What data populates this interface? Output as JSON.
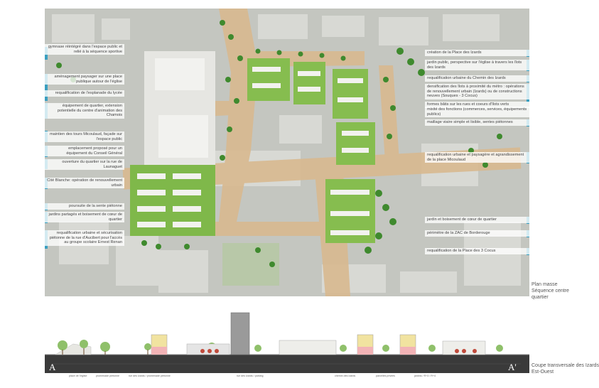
{
  "caption_plan": [
    "Plan masse",
    "Séquence centre",
    "quartier"
  ],
  "caption_section": [
    "Coupe transversale des Izards",
    "Est-Ouest"
  ],
  "section_letters": {
    "left": "A",
    "right": "A'"
  },
  "section_small_labels": [
    "place de l'église",
    "promenade piétonne",
    "rue des Izards / promenade piétonne",
    "rue des Izards / parking",
    "chemin des Izards",
    "parcelles privées",
    "jardins / R+3 / R+4"
  ],
  "left_annotations": [
    "gymnase réintégré dans l'espace public et relié à la séquence sportive",
    "aménagement paysager sur une place publique autour de l'église",
    "requalification de l'esplanade du lycée",
    "équipement de quartier, extension potentielle du centre d'animation des Chamois",
    "maintien des tours Micoulaud, façade sur l'espace public",
    "emplacement proposé pour un équipement du Conseil Général",
    "ouverture du quartier sur la rue de Launaguet",
    "Cité Blanche: opération de renouvellement urbain",
    "poursuite de la sente piétonne",
    "jardins partagés et boisement de cœur de quartier",
    "requalification urbaine et sécurisation piétonne de la rue d'Aucibert pour l'accès au groupe scolaire Ernest Renan"
  ],
  "right_annotations": [
    "création de la Place des Izards",
    "jardin public, perspective sur l'église à travers les îlots des Izards",
    "requalification urbaine du Chemin des Izards",
    "densification des îlots à proximité du métro : opérations de renouvellement urbain (Izards) ou de constructions neuves (Souques - 3 Cocus)",
    "formes bâtis sur les rues et coeurs d'îlots verts",
    "mixité des fonctions (commerces, services, équipements publics)",
    "maillage viaire simple et lisible, sentes piétonnes",
    "requalification urbaine et paysagère et agrandissement de la place Micoulaud",
    "jardin et boisement de cœur de quartier",
    "périmètre de la ZAC de Borderouge",
    "requalification de la Place des 3 Cocus"
  ]
}
